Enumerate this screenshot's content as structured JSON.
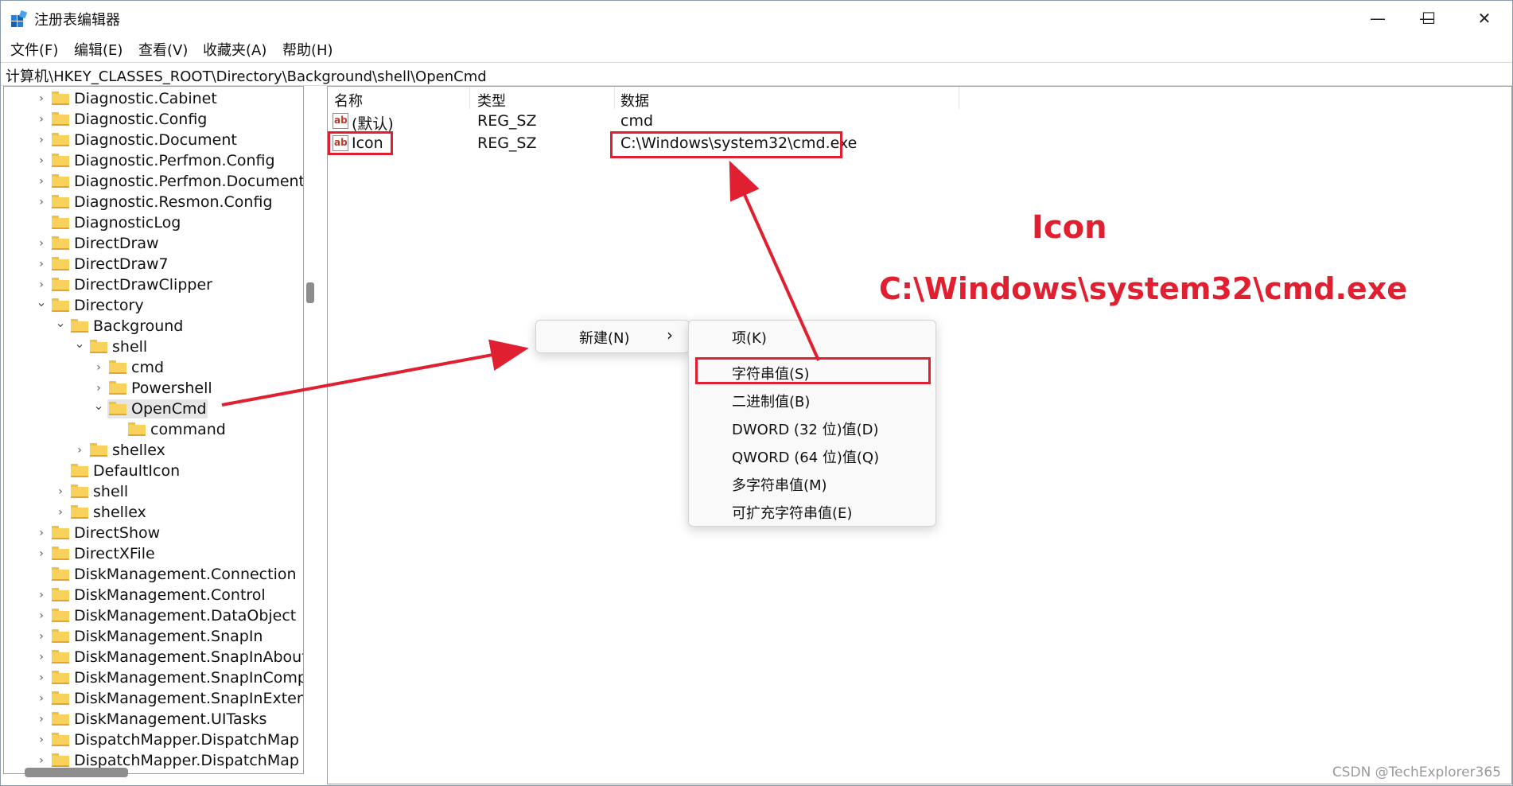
{
  "window": {
    "title": "注册表编辑器",
    "controls": [
      "—",
      "☐",
      "✕"
    ]
  },
  "menubar": [
    "文件(F)",
    "编辑(E)",
    "查看(V)",
    "收藏夹(A)",
    "帮助(H)"
  ],
  "address": "计算机\\HKEY_CLASSES_ROOT\\Directory\\Background\\shell\\OpenCmd",
  "tree": [
    {
      "label": "Diagnostic.Cabinet"
    },
    {
      "label": "Diagnostic.Config"
    },
    {
      "label": "Diagnostic.Document"
    },
    {
      "label": "Diagnostic.Perfmon.Config"
    },
    {
      "label": "Diagnostic.Perfmon.Document"
    },
    {
      "label": "Diagnostic.Resmon.Config"
    },
    {
      "label": "DiagnosticLog"
    },
    {
      "label": "DirectDraw"
    },
    {
      "label": "DirectDraw7"
    },
    {
      "label": "DirectDrawClipper"
    },
    {
      "label": "Directory"
    },
    {
      "label": "Background"
    },
    {
      "label": "shell"
    },
    {
      "label": "cmd"
    },
    {
      "label": "Powershell"
    },
    {
      "label": "OpenCmd"
    },
    {
      "label": "command"
    },
    {
      "label": "shellex"
    },
    {
      "label": "DefaultIcon"
    },
    {
      "label": "shell"
    },
    {
      "label": "shellex"
    },
    {
      "label": "DirectShow"
    },
    {
      "label": "DirectXFile"
    },
    {
      "label": "DiskManagement.Connection"
    },
    {
      "label": "DiskManagement.Control"
    },
    {
      "label": "DiskManagement.DataObject"
    },
    {
      "label": "DiskManagement.SnapIn"
    },
    {
      "label": "DiskManagement.SnapInAbout"
    },
    {
      "label": "DiskManagement.SnapInComp"
    },
    {
      "label": "DiskManagement.SnapInExtens"
    },
    {
      "label": "DiskManagement.UITasks"
    },
    {
      "label": "DispatchMapper.DispatchMap"
    },
    {
      "label": "DispatchMapper.DispatchMap"
    }
  ],
  "values_pane": {
    "headers": [
      "名称",
      "类型",
      "数据"
    ],
    "rows": [
      {
        "name": "(默认)",
        "type": "REG_SZ",
        "data": "cmd"
      },
      {
        "name": "Icon",
        "type": "REG_SZ",
        "data": "C:\\Windows\\system32\\cmd.exe"
      }
    ]
  },
  "context_menu": {
    "new_label": "新建(N)",
    "submenu_arrow": "›",
    "submenu": [
      "项(K)",
      "字符串值(S)",
      "二进制值(B)",
      "DWORD (32 位)值(D)",
      "QWORD (64 位)值(Q)",
      "多字符串值(M)",
      "可扩充字符串值(E)"
    ]
  },
  "annotations": {
    "name_label": "Icon",
    "path_label": "C:\\Windows\\system32\\cmd.exe",
    "color": "#e02030"
  },
  "watermark": "CSDN @TechExplorer365"
}
